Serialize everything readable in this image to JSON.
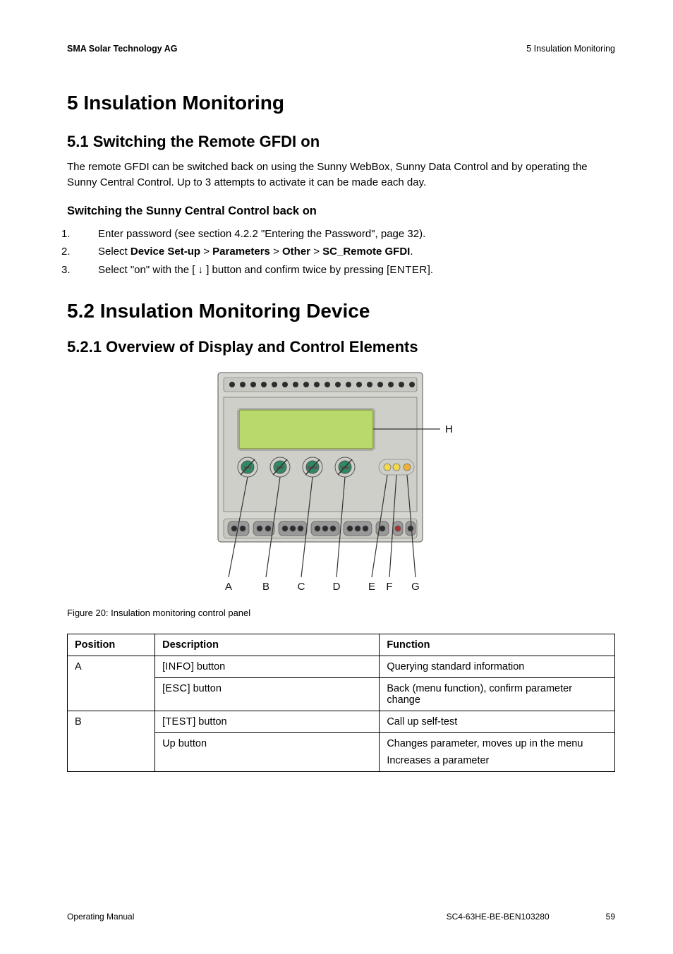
{
  "header": {
    "left": "SMA Solar Technology AG",
    "right": "5 Insulation Monitoring"
  },
  "h1": "5   Insulation Monitoring",
  "s51": {
    "title": "5.1  Switching the Remote GFDI on",
    "para": "The remote GFDI can be switched back on using the Sunny WebBox, Sunny Data Control and by operating the Sunny Central Control. Up to 3 attempts to activate it can be made each day.",
    "sub": "Switching the Sunny Central Control back on",
    "step1": "Enter password (see section 4.2.2 \"Entering the Password\", page 32).",
    "step2_pre": "Select ",
    "step2_b1": "Device Set-up",
    "step2_gt1": " > ",
    "step2_b2": "Parameters",
    "step2_gt2": " > ",
    "step2_b3": "Other",
    "step2_gt3": " > ",
    "step2_b4": "SC_Remote GFDI",
    "step2_end": ".",
    "step3_pre": "Select \"on\" with the [  ↓  ] button and confirm twice by pressing [",
    "step3_enter": "ENTER",
    "step3_end": "]."
  },
  "s52": {
    "title": "5.2  Insulation Monitoring Device",
    "sub": "5.2.1  Overview of Display and Control Elements"
  },
  "device": {
    "btn_info": "INFO",
    "btn_test": "TEST",
    "btn_reset": "RESET",
    "btn_menu": "MENU",
    "labelA": "A",
    "labelB": "B",
    "labelC": "C",
    "labelD": "D",
    "labelE": "E",
    "labelF": "F",
    "labelG": "G",
    "labelH": "H"
  },
  "caption": "Figure 20:  Insulation monitoring control panel",
  "table": {
    "h_pos": "Position",
    "h_desc": "Description",
    "h_func": "Function",
    "rows": [
      {
        "pos": "A",
        "desc_pre": "[",
        "desc_code": "INFO",
        "desc_post": "] button",
        "func": "Querying standard information"
      },
      {
        "pos": "",
        "desc_pre": "[",
        "desc_code": "ESC",
        "desc_post": "] button",
        "func": "Back (menu function), confirm parameter change"
      },
      {
        "pos": "B",
        "desc_pre": "[",
        "desc_code": "TEST",
        "desc_post": "] button",
        "func": "Call up self-test"
      },
      {
        "pos": "",
        "desc_plain": "Up button",
        "func": "Changes parameter, moves up in the menu",
        "func2": "Increases a parameter"
      }
    ]
  },
  "footer": {
    "left": "Operating Manual",
    "mid": "SC4-63HE-BE-BEN103280",
    "page": "59"
  }
}
